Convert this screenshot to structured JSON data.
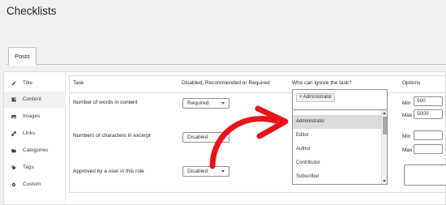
{
  "page": {
    "title": "Checklists"
  },
  "tabs": [
    {
      "label": "Posts"
    }
  ],
  "sidebar": {
    "items": [
      {
        "label": "Title",
        "icon": "pencil-icon",
        "active": false
      },
      {
        "label": "Content",
        "icon": "content-icon",
        "active": true
      },
      {
        "label": "Images",
        "icon": "images-icon",
        "active": false
      },
      {
        "label": "Links",
        "icon": "link-icon",
        "active": false
      },
      {
        "label": "Categories",
        "icon": "folder-icon",
        "active": false
      },
      {
        "label": "Tags",
        "icon": "tag-icon",
        "active": false
      },
      {
        "label": "Custom",
        "icon": "gear-icon",
        "active": false
      }
    ]
  },
  "table": {
    "headers": {
      "task": "Task",
      "status": "Disabled, Recommended or Required",
      "who": "Who can ignore the task?",
      "options": "Options"
    },
    "rows": [
      {
        "task": "Number of words in content",
        "status": "Required"
      },
      {
        "task": "Numbers of characters in excerpt",
        "status": "Disabled"
      },
      {
        "task": "Approved by a user in this role",
        "status": "Disabled"
      }
    ]
  },
  "role_select": {
    "selected_chip": "× Administrator",
    "options": [
      "Administrator",
      "Editor",
      "Author",
      "Contributor",
      "Subscriber"
    ],
    "highlighted": "Administrator"
  },
  "options": {
    "min_label": "Min",
    "max_label": "Max",
    "row1_min": "500",
    "row1_max": "5000",
    "row2_min": "",
    "row2_max": ""
  },
  "colors": {
    "annotation_arrow": "#e8141b",
    "highlight": "#dcdcde"
  }
}
